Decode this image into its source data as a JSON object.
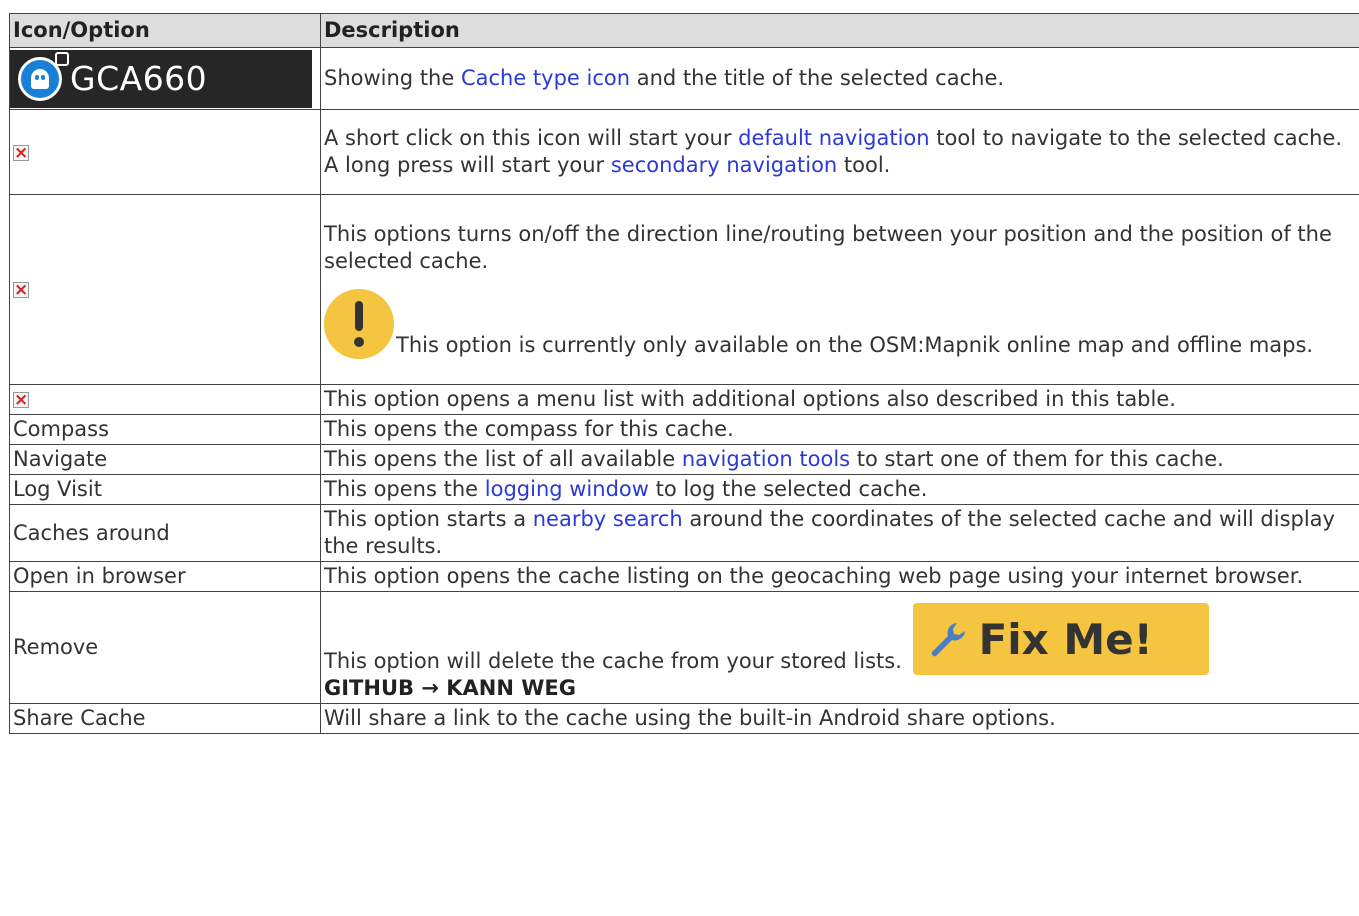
{
  "header": {
    "col1": "Icon/Option",
    "col2": "Description"
  },
  "row_logo": {
    "icon": "cache-type-ghost-icon",
    "logo_text": "GCA660",
    "desc_pre": "Showing the ",
    "link": "Cache type icon",
    "desc_post": " and the title of the selected cache."
  },
  "row_nav": {
    "icon": "broken-image-icon",
    "line1_pre": "A short click on this icon will start your ",
    "line1_link": "default navigation",
    "line1_post": " tool to navigate to the selected cache.",
    "line2_pre": "A long press will start your ",
    "line2_link": "secondary navigation",
    "line2_post": " tool."
  },
  "row_direction": {
    "icon": "broken-image-icon",
    "text": "This options turns on/off the direction line/routing between your position and the position of the selected cache.",
    "warning_icon": "exclamation-warning-icon",
    "warning": "This option is currently only available on the OSM:Mapnik online map and offline maps."
  },
  "row_menu": {
    "icon": "broken-image-icon",
    "text": "This option opens a menu list with additional options also described in this table."
  },
  "rows": [
    {
      "option": "Compass",
      "pre": "This opens the compass for this cache.",
      "link": "",
      "post": ""
    },
    {
      "option": "Navigate",
      "pre": "This opens the list of all available ",
      "link": "navigation tools",
      "post": " to start one of them for this cache."
    },
    {
      "option": "Log Visit",
      "pre": "This opens the ",
      "link": "logging window",
      "post": " to log the selected cache."
    },
    {
      "option": "Caches around",
      "pre": "This option starts a ",
      "link": "nearby search",
      "post": " around the coordinates of the selected cache and will display the results."
    },
    {
      "option": "Open in browser",
      "pre": "This option opens the cache listing on the geocaching web page using your internet browser.",
      "link": "",
      "post": ""
    }
  ],
  "row_remove": {
    "option": "Remove",
    "text": "This option will delete the cache from your stored lists.",
    "fixme_icon": "wrench-icon",
    "fixme": "Fix Me!",
    "note": "GITHUB → KANN WEG"
  },
  "row_share": {
    "option": "Share Cache",
    "text": "Will share a link to the cache using the built-in Android share options."
  },
  "colors": {
    "link": "#2a3ad8",
    "header_bg": "#dddddd",
    "border": "#444444",
    "warning": "#f5c542",
    "logo_bg": "#262626",
    "ghost_blue": "#1a7fd6"
  }
}
